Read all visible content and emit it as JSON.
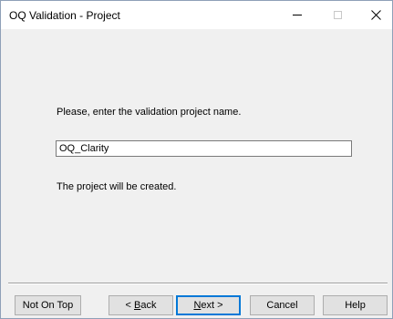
{
  "window": {
    "title": "OQ Validation - Project",
    "minimize_glyph": "—",
    "close_glyph": "✕"
  },
  "content": {
    "prompt": "Please, enter the validation project name.",
    "project_name_value": "OQ_Clarity",
    "status": "The project will be created."
  },
  "buttons": {
    "not_on_top": "Not On Top",
    "back_prefix": "< ",
    "back_mnemonic": "B",
    "back_rest": "ack",
    "next_mnemonic": "N",
    "next_rest": "ext >",
    "cancel": "Cancel",
    "help": "Help"
  },
  "colors": {
    "accent": "#0078d7",
    "client_bg": "#f0f0f0"
  }
}
